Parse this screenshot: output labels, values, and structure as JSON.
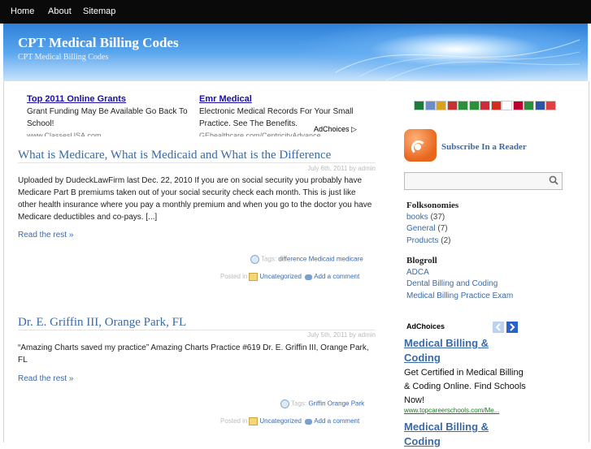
{
  "nav": {
    "items": [
      "Home",
      "About",
      "Sitemap"
    ]
  },
  "header": {
    "title": "CPT Medical Billing Codes",
    "subtitle": "CPT Medical Billing Codes"
  },
  "top_ads": [
    {
      "title": "Top 2011 Online Grants",
      "line1": "Grant Funding May Be Available Go Back To",
      "line2": "School!",
      "url": "www.ClassesUSA.com"
    },
    {
      "title": "Emr Medical",
      "line1": "Electronic Medical Records For Your Small",
      "line2": "Practice. See The Benefits.",
      "url": "GEhealthcare.com/CentricityAdvance"
    }
  ],
  "adchoices_label": "AdChoices",
  "adchoices_glyph": "▷",
  "posts": [
    {
      "title": "What is Medicare, What is Medicaid and What is the Difference",
      "meta": "July 6th, 2011 by admin",
      "body": "Uploaded by DudeckLawFirm last Dec. 22, 2010 If you are on social security you probably have Medicare Part B premiums taken out of your social security check each month. This is just like other health insurance where you pay a monthly premium and when you go to the doctor you have Medicare deductibles and co-pays. [...]",
      "read_more": "Read the rest »",
      "tags_label": "Tags:",
      "tags": [
        "difference",
        "Medicaid",
        "medicare"
      ],
      "posted_in": "Posted in",
      "category": "Uncategorized",
      "comment": "Add a comment"
    },
    {
      "title": "Dr. E. Griffin III, Orange Park, FL",
      "meta": "July 5th, 2011 by admin",
      "body": "“Amazing Charts saved my practice” Amazing Charts Practice #619 Dr. E. Griffin III, Orange Park, FL",
      "read_more": "Read the rest »",
      "tags_label": "Tags:",
      "tags": [
        "Griffin",
        "Orange",
        "Park"
      ],
      "posted_in": "Posted in",
      "category": "Uncategorized",
      "comment": "Add a comment"
    }
  ],
  "sidebar": {
    "flag_colors": [
      "#1d7a3a",
      "#6b8cc6",
      "#d9a21a",
      "#c8322e",
      "#2e8f3a",
      "#2e8f3a",
      "#ce2b37",
      "#d52b1e",
      "#ffffff",
      "#bc002d",
      "#2e8f3a",
      "#2a54a8",
      "#e04040"
    ],
    "subscribe_label": "Subscribe In a Reader",
    "folksonomies_heading": "Folksonomies",
    "folksonomies": [
      {
        "label": "books",
        "count": "(37)"
      },
      {
        "label": "General",
        "count": "(7)"
      },
      {
        "label": "Products",
        "count": "(2)"
      }
    ],
    "blogroll_heading": "Blogroll",
    "blogroll": [
      "ADCA",
      "Dental Billing and Coding",
      "Medical Billing Practice Exam"
    ],
    "ad": {
      "label": "AdChoices",
      "title_line1": "Medical Billing &",
      "title_line2": "Coding",
      "body": "Get Certified in Medical Billing & Coding Online. Find Schools Now!",
      "url": "www.topcareerschools.com/Me...",
      "title2_line1": "Medical Billing &",
      "title2_line2": "Coding"
    }
  },
  "colors": {
    "link": "#3a6aa8",
    "nav_bg": "#0a0a0a",
    "banner": "#2e80d8"
  }
}
